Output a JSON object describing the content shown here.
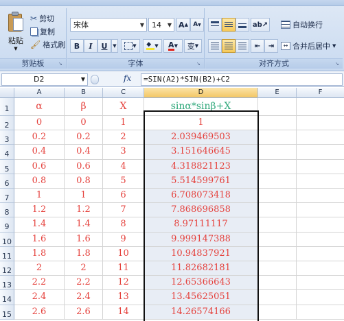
{
  "ribbon": {
    "clipboard": {
      "paste_label": "粘贴",
      "cut_label": "剪切",
      "copy_label": "复制",
      "format_painter_label": "格式刷",
      "group_label": "剪贴板"
    },
    "font": {
      "font_name": "宋体",
      "font_size": "14",
      "grow_label": "A",
      "shrink_label": "A",
      "bold_label": "B",
      "italic_label": "I",
      "underline_label": "U",
      "font_color_label": "A",
      "phonetic_label": "变",
      "group_label": "字体"
    },
    "alignment": {
      "wrap_text_label": "自动换行",
      "merge_center_label": "合并后居中",
      "group_label": "对齐方式"
    }
  },
  "formula_bar": {
    "name_box": "D2",
    "fx_label": "fx",
    "formula": "=SIN(A2)*SIN(B2)+C2"
  },
  "sheet": {
    "columns": [
      "A",
      "B",
      "C",
      "D",
      "E",
      "F"
    ],
    "selected_column": "D",
    "row_numbers": [
      "1",
      "2",
      "3",
      "4",
      "5",
      "6",
      "7",
      "8",
      "9",
      "10",
      "11",
      "12",
      "13",
      "14",
      "15"
    ],
    "header_row": [
      "α",
      "β",
      "X",
      "sinα*sinβ+X"
    ],
    "rows": [
      [
        "0",
        "0",
        "1",
        "1"
      ],
      [
        "0.2",
        "0.2",
        "2",
        "2.039469503"
      ],
      [
        "0.4",
        "0.4",
        "3",
        "3.151646645"
      ],
      [
        "0.6",
        "0.6",
        "4",
        "4.318821123"
      ],
      [
        "0.8",
        "0.8",
        "5",
        "5.514599761"
      ],
      [
        "1",
        "1",
        "6",
        "6.708073418"
      ],
      [
        "1.2",
        "1.2",
        "7",
        "7.868696858"
      ],
      [
        "1.4",
        "1.4",
        "8",
        "8.97111117"
      ],
      [
        "1.6",
        "1.6",
        "9",
        "9.999147388"
      ],
      [
        "1.8",
        "1.8",
        "10",
        "10.94837921"
      ],
      [
        "2",
        "2",
        "11",
        "11.82682181"
      ],
      [
        "2.2",
        "2.2",
        "12",
        "12.65366643"
      ],
      [
        "2.4",
        "2.4",
        "13",
        "13.45625051"
      ],
      [
        "2.6",
        "2.6",
        "14",
        "14.26574166"
      ]
    ]
  },
  "colors": {
    "data_text": "#e5423d",
    "header_formula_text": "#2fa87a",
    "selected_range_fill": "#e8edf5"
  }
}
